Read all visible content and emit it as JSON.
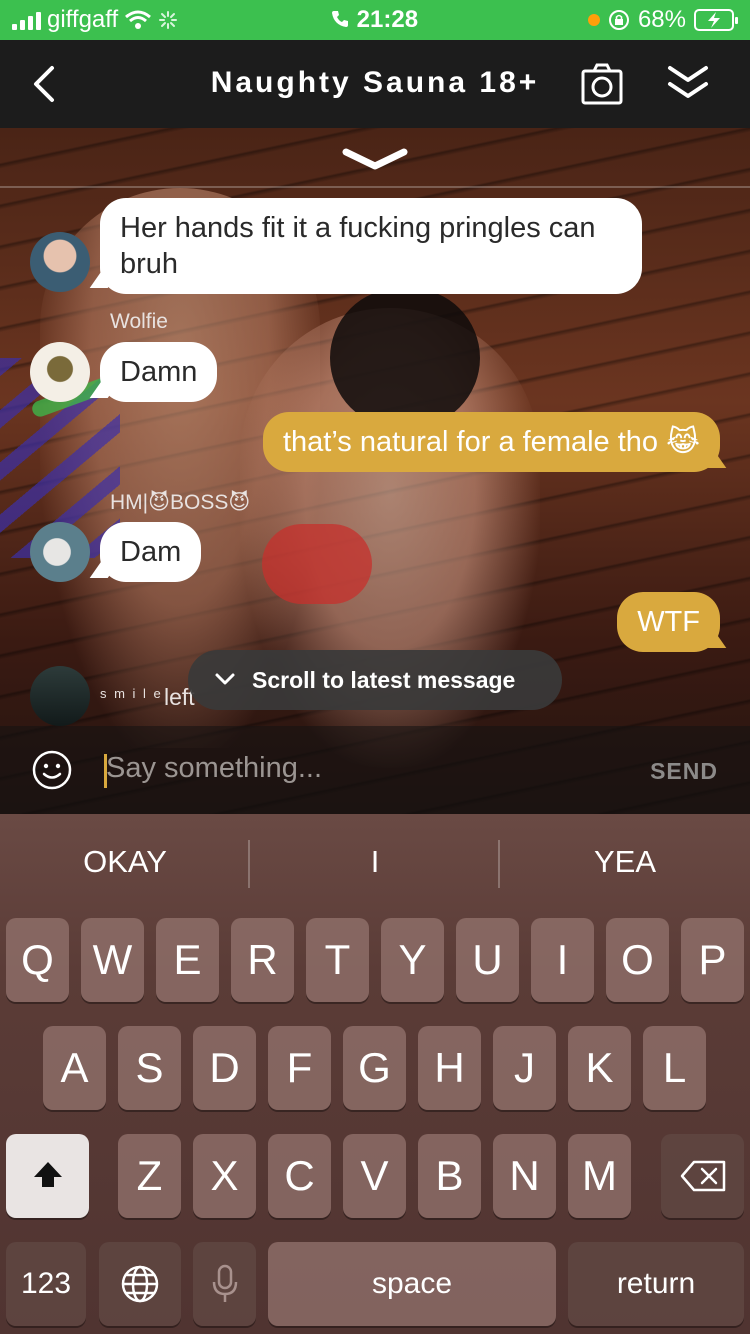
{
  "status_bar": {
    "carrier": "giffgaff",
    "time": "21:28",
    "battery": "68%"
  },
  "header": {
    "title": "Naughty Sauna 18+"
  },
  "messages": [
    {
      "sender": "",
      "text": "Her hands fit it a fucking pringles can bruh",
      "direction": "incoming"
    },
    {
      "sender": "Wolfie",
      "text": "Damn",
      "direction": "incoming"
    },
    {
      "sender": "",
      "text": "that’s natural for a female tho 😹",
      "direction": "outgoing"
    },
    {
      "sender": "HM|😈BOSS😈",
      "text": "Dam",
      "direction": "incoming"
    },
    {
      "sender": "",
      "text": "WTF",
      "direction": "outgoing"
    }
  ],
  "system_message": {
    "user": "s m i l e",
    "text": "left"
  },
  "scroll_button": {
    "label": "Scroll to latest message"
  },
  "composer": {
    "placeholder": "Say something...",
    "send_label": "SEND"
  },
  "keyboard": {
    "suggestions": [
      "OKAY",
      "I",
      "YEA"
    ],
    "row1": [
      "Q",
      "W",
      "E",
      "R",
      "T",
      "Y",
      "U",
      "I",
      "O",
      "P"
    ],
    "row2": [
      "A",
      "S",
      "D",
      "F",
      "G",
      "H",
      "J",
      "K",
      "L"
    ],
    "row3": [
      "Z",
      "X",
      "C",
      "V",
      "B",
      "N",
      "M"
    ],
    "numbers_label": "123",
    "space_label": "space",
    "return_label": "return"
  },
  "colors": {
    "status_green": "#3cc04f",
    "outgoing_bubble": "#d9a93e",
    "incoming_bubble": "#ffffff",
    "header_bg": "#1c1c1c"
  },
  "icons": {
    "back": "chevron-left-icon",
    "camera": "camera-icon",
    "collapse": "double-chevron-down-icon",
    "emoji": "smiley-icon",
    "shift": "shift-arrow-icon",
    "delete": "backspace-icon",
    "globe": "globe-icon",
    "mic": "microphone-icon"
  }
}
